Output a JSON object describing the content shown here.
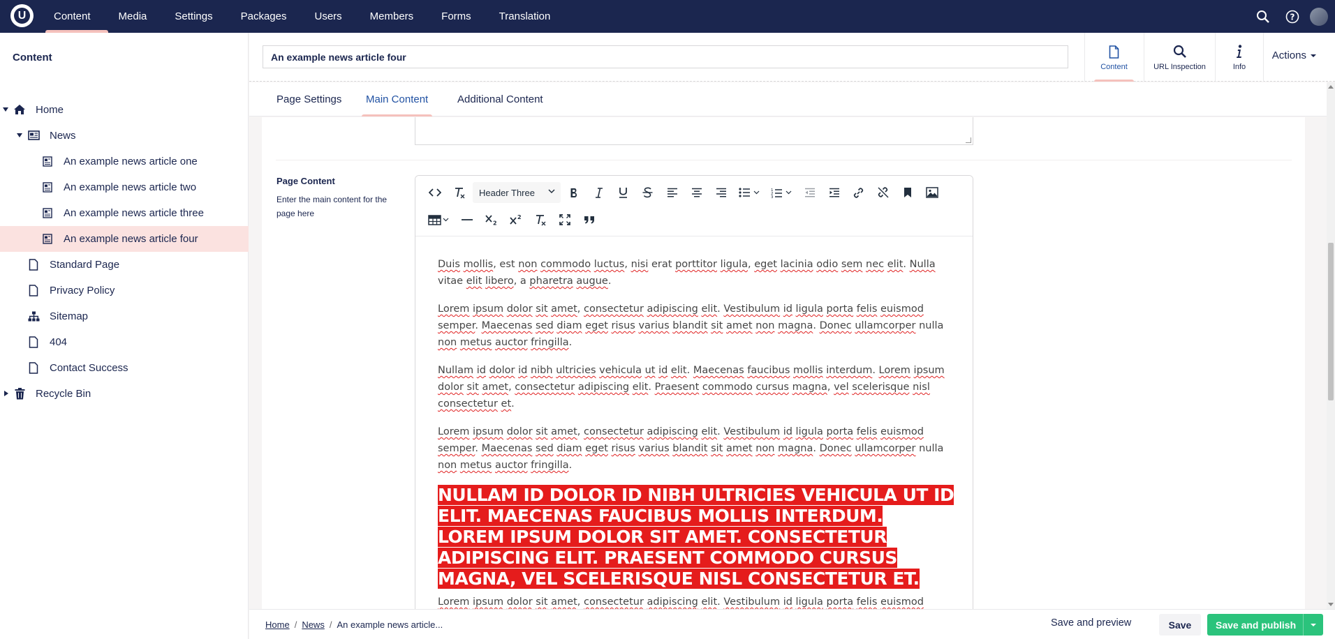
{
  "topbar": {
    "logo": "U",
    "nav": [
      "Content",
      "Media",
      "Settings",
      "Packages",
      "Users",
      "Members",
      "Forms",
      "Translation"
    ],
    "active_nav": "Content"
  },
  "sidebar": {
    "title": "Content",
    "tree": {
      "home": "Home",
      "news": "News",
      "article_one": "An example news article one",
      "article_two": "An example news article two",
      "article_three": "An example news article three",
      "article_four": "An example news article four",
      "standard_page": "Standard Page",
      "privacy_policy": "Privacy Policy",
      "sitemap": "Sitemap",
      "not_found": "404",
      "contact_success": "Contact Success",
      "recycle_bin": "Recycle Bin"
    }
  },
  "header": {
    "name_value": "An example news article four",
    "apps": {
      "content": "Content",
      "url_inspection": "URL Inspection",
      "info": "Info"
    },
    "actions": "Actions"
  },
  "subtabs": {
    "page_settings": "Page Settings",
    "main_content": "Main Content",
    "additional_content": "Additional Content"
  },
  "property": {
    "label": "Page Content",
    "description": "Enter the main content for the page here"
  },
  "toolbar": {
    "format_select": "Header Three"
  },
  "content": {
    "p1": "Duis mollis, est non commodo luctus, nisi erat porttitor ligula, eget lacinia odio sem nec elit. Nulla vitae elit libero, a pharetra augue.",
    "p2": "Lorem ipsum dolor sit amet, consectetur adipiscing elit. Vestibulum id ligula porta felis euismod semper. Maecenas sed diam eget risus varius blandit sit amet non magna. Donec ullamcorper nulla non metus auctor fringilla.",
    "p3": "Nullam id dolor id nibh ultricies vehicula ut id elit. Maecenas faucibus mollis interdum. Lorem ipsum dolor sit amet, consectetur adipiscing elit. Praesent commodo cursus magna, vel scelerisque nisl consectetur et.",
    "p4": "Lorem ipsum dolor sit amet, consectetur adipiscing elit. Vestibulum id ligula porta felis euismod semper. Maecenas sed diam eget risus varius blandit sit amet non magna. Donec ullamcorper nulla non metus auctor fringilla.",
    "h3": "Nullam id dolor id nibh ultricies vehicula ut id elit. Maecenas faucibus mollis interdum. Lorem ipsum dolor sit amet. consectetur adipiscing elit. Praesent commodo cursus magna, vel scelerisque nisl consectetur et.",
    "p5": "Lorem ipsum dolor sit amet, consectetur adipiscing elit. Vestibulum id ligula porta felis euismod semper. Maecenas sed diam eget risus varius blandit sit amet non magna. Donec ullamcorper nulla"
  },
  "footer": {
    "breadcrumb": {
      "home": "Home",
      "news": "News",
      "current": "An example news article..."
    },
    "save_preview": "Save and preview",
    "save": "Save",
    "publish": "Save and publish"
  },
  "colors": {
    "topbar": "#1b264f",
    "accent": "#f5c1bc",
    "publish": "#2bc37c",
    "highlight": "#e51c1c"
  }
}
